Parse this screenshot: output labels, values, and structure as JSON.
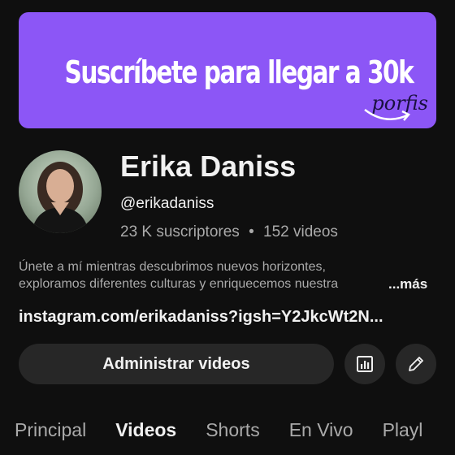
{
  "banner": {
    "title": "Suscríbete para llegar a 30k",
    "subtitle": "porfis",
    "color": "#8c56f6"
  },
  "channel": {
    "name": "Erika Daniss",
    "handle": "@erikadaniss",
    "subscribers": "23 K suscriptores",
    "separator": "•",
    "videos": "152 videos",
    "description_line1": "Únete a mí mientras descubrimos nuevos horizontes,",
    "description_line2": "exploramos diferentes culturas y enriquecemos nuestra",
    "more_label": "...más",
    "link": "instagram.com/erikadaniss?igsh=Y2JkcWt2N..."
  },
  "actions": {
    "manage_label": "Administrar videos",
    "analytics_icon": "analytics-icon",
    "edit_icon": "pencil-icon"
  },
  "tabs": [
    {
      "label": "Principal",
      "active": false
    },
    {
      "label": "Videos",
      "active": true
    },
    {
      "label": "Shorts",
      "active": false
    },
    {
      "label": "En Vivo",
      "active": false
    },
    {
      "label": "Playl",
      "active": false
    }
  ]
}
